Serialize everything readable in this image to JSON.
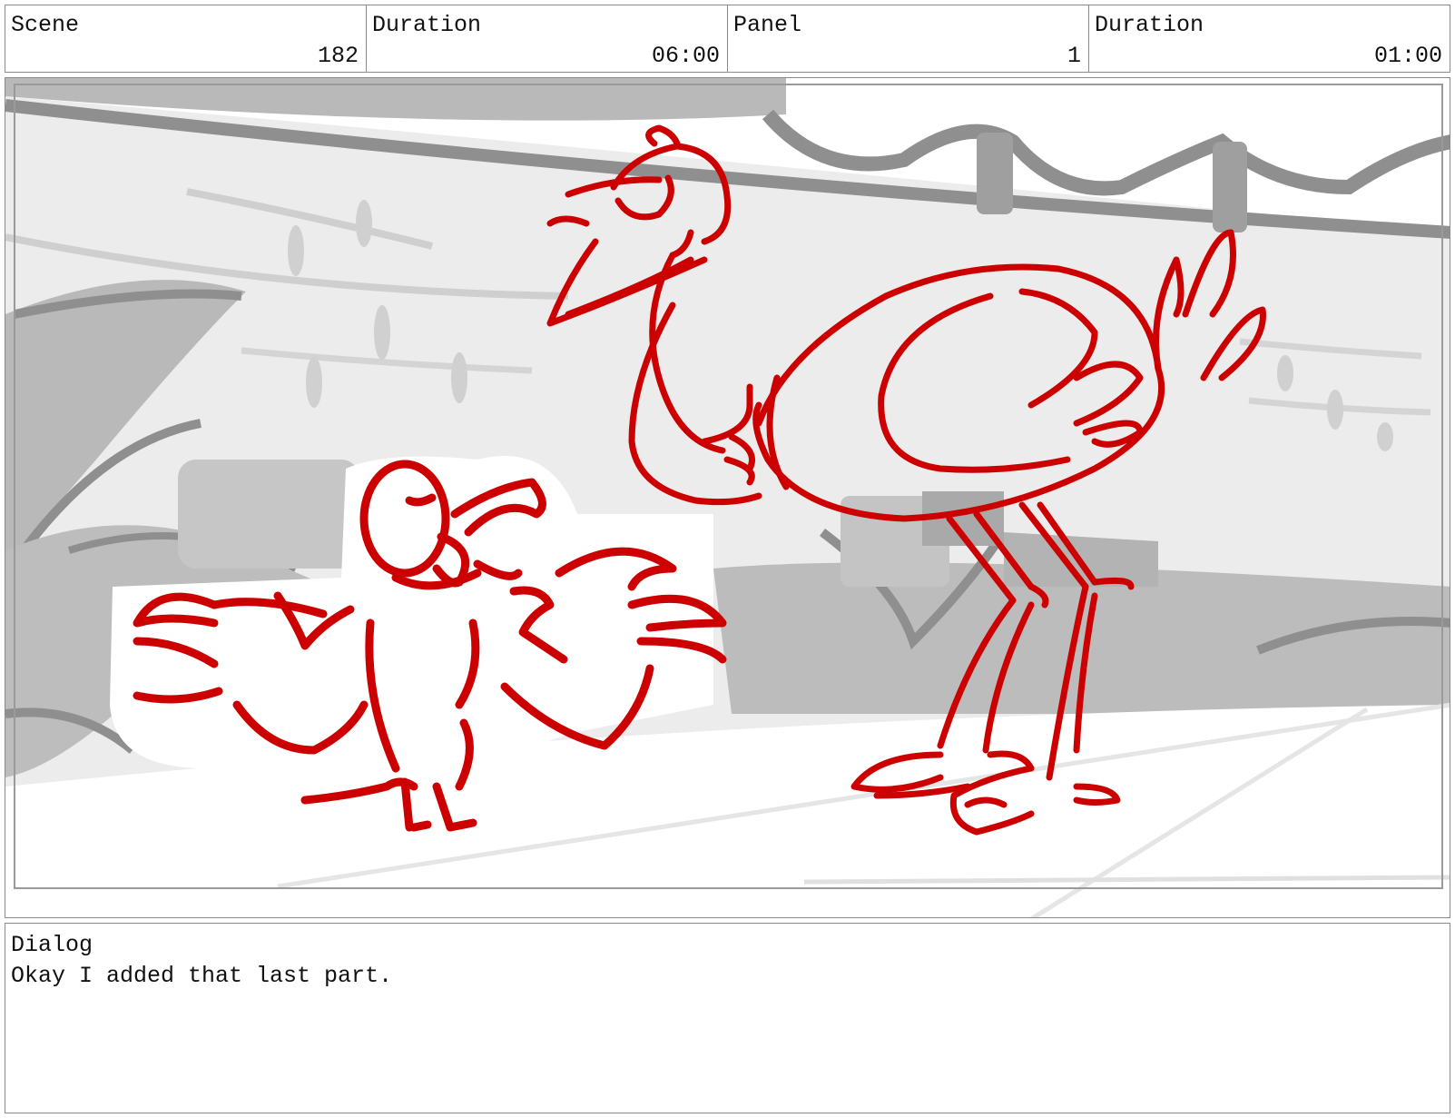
{
  "header": {
    "fields": [
      {
        "label": "Scene",
        "value": "182"
      },
      {
        "label": "Duration",
        "value": "06:00"
      },
      {
        "label": "Panel",
        "value": "1"
      },
      {
        "label": "Duration",
        "value": "01:00"
      }
    ]
  },
  "panel": {
    "drawing_colors": {
      "ink": "#cc0000",
      "background_dark": "#8f8f8f",
      "background_mid": "#b9b9b9",
      "background_light": "#ececec"
    }
  },
  "dialog": {
    "label": "Dialog",
    "text": "Okay I added that last part."
  }
}
